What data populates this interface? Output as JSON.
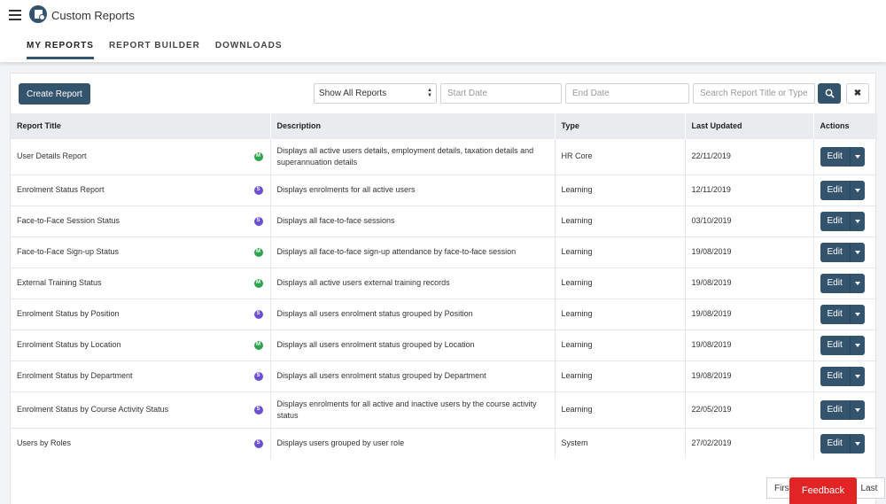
{
  "app": {
    "title": "Custom Reports"
  },
  "tabs": [
    {
      "label": "MY REPORTS",
      "active": true
    },
    {
      "label": "REPORT BUILDER",
      "active": false
    },
    {
      "label": "DOWNLOADS",
      "active": false
    }
  ],
  "toolbar": {
    "create_label": "Create Report",
    "filter_selected": "Show All Reports",
    "start_date_placeholder": "Start Date",
    "end_date_placeholder": "End Date",
    "search_placeholder": "Search Report Title or Type",
    "clear_label": "✖"
  },
  "table": {
    "headers": [
      "Report Title",
      "Description",
      "Type",
      "Last Updated",
      "Actions"
    ],
    "rows": [
      {
        "title": "User Details Report",
        "badge": "M",
        "description": "Displays all active users details, employment details, taxation details and superannuation details",
        "type": "HR Core",
        "updated": "22/11/2019",
        "action": "Edit"
      },
      {
        "title": "Enrolment Status Report",
        "badge": "S",
        "description": "Displays enrolments for all active users",
        "type": "Learning",
        "updated": "12/11/2019",
        "action": "Edit"
      },
      {
        "title": "Face-to-Face Session Status",
        "badge": "S",
        "description": "Displays all face-to-face sessions",
        "type": "Learning",
        "updated": "03/10/2019",
        "action": "Edit"
      },
      {
        "title": "Face-to-Face Sign-up Status",
        "badge": "M",
        "description": "Displays all face-to-face sign-up attendance by face-to-face session",
        "type": "Learning",
        "updated": "19/08/2019",
        "action": "Edit"
      },
      {
        "title": "External Training Status",
        "badge": "M",
        "description": "Displays all active users external training records",
        "type": "Learning",
        "updated": "19/08/2019",
        "action": "Edit"
      },
      {
        "title": "Enrolment Status by Position",
        "badge": "S",
        "description": "Displays all users enrolment status grouped by Position",
        "type": "Learning",
        "updated": "19/08/2019",
        "action": "Edit"
      },
      {
        "title": "Enrolment Status by Location",
        "badge": "M",
        "description": "Displays all users enrolment status grouped by Location",
        "type": "Learning",
        "updated": "19/08/2019",
        "action": "Edit"
      },
      {
        "title": "Enrolment Status by Department",
        "badge": "S",
        "description": "Displays all users enrolment status grouped by Department",
        "type": "Learning",
        "updated": "19/08/2019",
        "action": "Edit"
      },
      {
        "title": "Enrolment Status by Course Activity Status",
        "badge": "S",
        "description": "Displays enrolments for all active and inactive users by the course activity status",
        "type": "Learning",
        "updated": "22/05/2019",
        "action": "Edit"
      },
      {
        "title": "Users by Roles",
        "badge": "S",
        "description": "Displays users grouped by user role",
        "type": "System",
        "updated": "27/02/2019",
        "action": "Edit"
      }
    ]
  },
  "pager": {
    "first": "First",
    "last": "Last"
  },
  "feedback": {
    "label": "Feedback"
  },
  "colors": {
    "primary": "#34546d",
    "badge_m": "#2da44e",
    "badge_s": "#6a4fd6",
    "feedback": "#e32424"
  },
  "icons": {
    "menu": "hamburger-icon",
    "logo": "report-logo-icon",
    "search": "search-icon",
    "clear": "close-icon",
    "caret": "caret-down-icon"
  }
}
